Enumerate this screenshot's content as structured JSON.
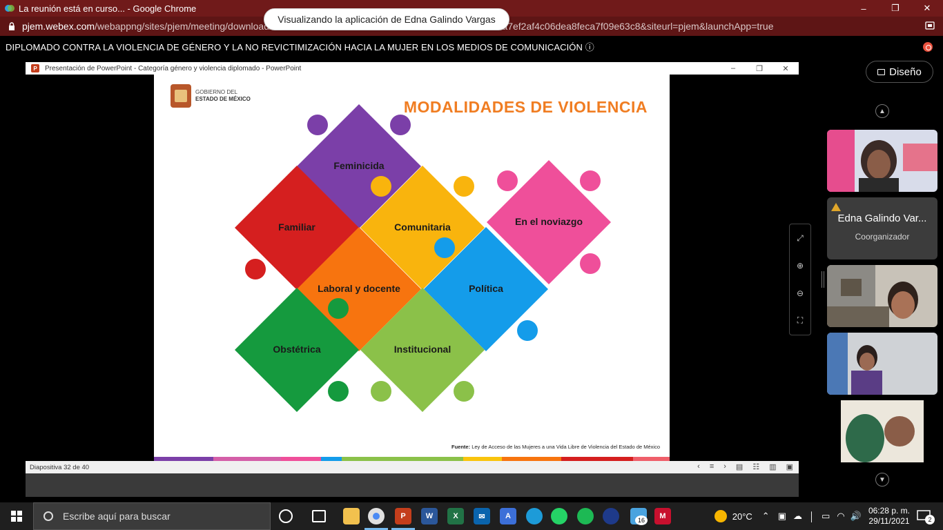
{
  "browser": {
    "tab_title": "La reunión está en curso... - Google Chrome",
    "url_host": "pjem.webex.com",
    "url_path": "/webappng/sites/pjem/meeting/download/1e1fa8c828674ab0b51540a4baef41ab?MTID=m4848a7ef2af4c06dea8feca7f09e63c8&siteurl=pjem&launchApp=true"
  },
  "meeting": {
    "title": "DIPLOMADO CONTRA LA VIOLENCIA DE GÉNERO Y LA NO REVICTIMIZACIÓN HACIA LA MUJER EN LOS MEDIOS DE COMUNICACIÓN",
    "info_symbol": "ⓘ",
    "sharing_notice": "Visualizando la aplicación de Edna Galindo Vargas",
    "layout_button": "Diseño"
  },
  "powerpoint": {
    "window_title": "Presentación de PowerPoint  -  Categoría género y violencia diplomado  -  PowerPoint",
    "slide_status": "Diapositiva 32 de 40"
  },
  "slide": {
    "title": "MODALIDADES DE VIOLENCIA",
    "gov_line1": "GOBIERNO DEL",
    "gov_line2": "ESTADO DE MÉXICO",
    "source_label": "Fuente:",
    "source_text": "Ley de Acceso de las Mujeres a una Vida Libre de Violencia del Estado de México",
    "pieces": [
      {
        "label": "Feminicida",
        "color": "#7b3fa8"
      },
      {
        "label": "Familiar",
        "color": "#d51f1f"
      },
      {
        "label": "Comunitaria",
        "color": "#f9b40d"
      },
      {
        "label": "En el noviazgo",
        "color": "#ef4f9a"
      },
      {
        "label": "Laboral y docente",
        "color": "#f7740f"
      },
      {
        "label": "Política",
        "color": "#149cea"
      },
      {
        "label": "Obstétrica",
        "color": "#159a3e"
      },
      {
        "label": "Institucional",
        "color": "#8bc149"
      }
    ],
    "stripe_colors": [
      "#7b3fa8",
      "#d45fa8",
      "#ef4f9a",
      "#149cea",
      "#8bc149",
      "#f9c40d",
      "#f7740f",
      "#d51f1f",
      "#ef5f6a"
    ]
  },
  "participants": [
    {
      "kind": "video",
      "bg": "#c4667c"
    },
    {
      "kind": "name",
      "name": "Edna Galindo Var...",
      "role": "Coorganizador",
      "bg": "#3c3c3c"
    },
    {
      "kind": "video",
      "bg": "#8a7a6e"
    },
    {
      "kind": "video",
      "bg": "#a39ab3"
    },
    {
      "kind": "video",
      "bg": "#e9e4d8"
    }
  ],
  "taskbar": {
    "search_placeholder": "Escribe aquí para buscar",
    "temperature": "20°C",
    "time": "06:28 p. m.",
    "date": "29/11/2021",
    "notification_count": "2",
    "app_badge": "16"
  }
}
